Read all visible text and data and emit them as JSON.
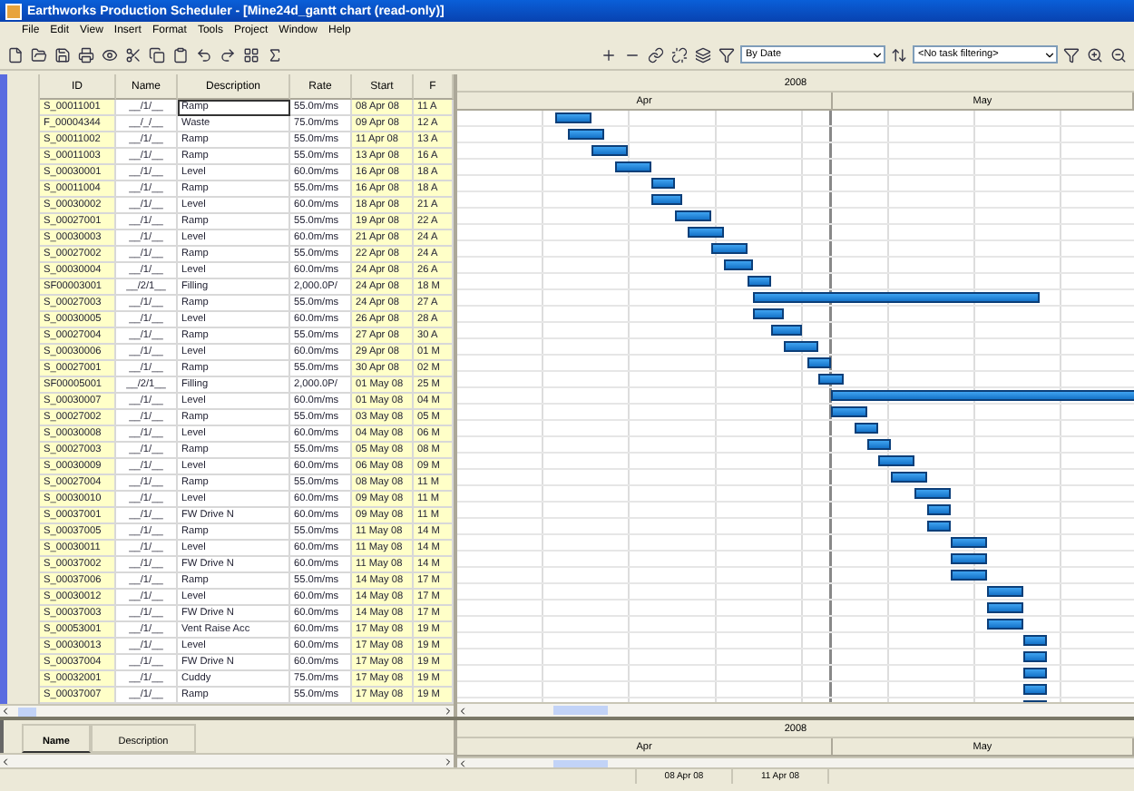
{
  "window": {
    "title": "Earthworks Production Scheduler - [Mine24d_gantt chart (read-only)]"
  },
  "menu": [
    "File",
    "Edit",
    "View",
    "Insert",
    "Format",
    "Tools",
    "Project",
    "Window",
    "Help"
  ],
  "toolbar": {
    "sort_select": "By Date",
    "filter_select": "<No task filtering>"
  },
  "table": {
    "columns": [
      "ID",
      "Name",
      "Description",
      "Rate",
      "Start",
      "F"
    ],
    "rows": [
      {
        "id": "S_00011001",
        "name": "__/1/__",
        "description": "Ramp",
        "rate": "55.0m/ms",
        "start": "08 Apr 08",
        "finish": "11 A",
        "selected": true
      },
      {
        "id": "F_00004344",
        "name": "__/_/__",
        "description": "Waste",
        "rate": "75.0m/ms",
        "start": "09 Apr 08",
        "finish": "12 A",
        "selected": false
      },
      {
        "id": "S_00011002",
        "name": "__/1/__",
        "description": "Ramp",
        "rate": "55.0m/ms",
        "start": "11 Apr 08",
        "finish": "13 A",
        "selected": false
      },
      {
        "id": "S_00011003",
        "name": "__/1/__",
        "description": "Ramp",
        "rate": "55.0m/ms",
        "start": "13 Apr 08",
        "finish": "16 A",
        "selected": false
      },
      {
        "id": "S_00030001",
        "name": "__/1/__",
        "description": "Level",
        "rate": "60.0m/ms",
        "start": "16 Apr 08",
        "finish": "18 A",
        "selected": false
      },
      {
        "id": "S_00011004",
        "name": "__/1/__",
        "description": "Ramp",
        "rate": "55.0m/ms",
        "start": "16 Apr 08",
        "finish": "18 A",
        "selected": false
      },
      {
        "id": "S_00030002",
        "name": "__/1/__",
        "description": "Level",
        "rate": "60.0m/ms",
        "start": "18 Apr 08",
        "finish": "21 A",
        "selected": false
      },
      {
        "id": "S_00027001",
        "name": "__/1/__",
        "description": "Ramp",
        "rate": "55.0m/ms",
        "start": "19 Apr 08",
        "finish": "22 A",
        "selected": false
      },
      {
        "id": "S_00030003",
        "name": "__/1/__",
        "description": "Level",
        "rate": "60.0m/ms",
        "start": "21 Apr 08",
        "finish": "24 A",
        "selected": false
      },
      {
        "id": "S_00027002",
        "name": "__/1/__",
        "description": "Ramp",
        "rate": "55.0m/ms",
        "start": "22 Apr 08",
        "finish": "24 A",
        "selected": false
      },
      {
        "id": "S_00030004",
        "name": "__/1/__",
        "description": "Level",
        "rate": "60.0m/ms",
        "start": "24 Apr 08",
        "finish": "26 A",
        "selected": false
      },
      {
        "id": "SF00003001",
        "name": "__/2/1__",
        "description": "Filling",
        "rate": "2,000.0P/",
        "start": "24 Apr 08",
        "finish": "18 M",
        "selected": false
      },
      {
        "id": "S_00027003",
        "name": "__/1/__",
        "description": "Ramp",
        "rate": "55.0m/ms",
        "start": "24 Apr 08",
        "finish": "27 A",
        "selected": false
      },
      {
        "id": "S_00030005",
        "name": "__/1/__",
        "description": "Level",
        "rate": "60.0m/ms",
        "start": "26 Apr 08",
        "finish": "28 A",
        "selected": false
      },
      {
        "id": "S_00027004",
        "name": "__/1/__",
        "description": "Ramp",
        "rate": "55.0m/ms",
        "start": "27 Apr 08",
        "finish": "30 A",
        "selected": false
      },
      {
        "id": "S_00030006",
        "name": "__/1/__",
        "description": "Level",
        "rate": "60.0m/ms",
        "start": "29 Apr 08",
        "finish": "01 M",
        "selected": false
      },
      {
        "id": "S_00027001",
        "name": "__/1/__",
        "description": "Ramp",
        "rate": "55.0m/ms",
        "start": "30 Apr 08",
        "finish": "02 M",
        "selected": false
      },
      {
        "id": "SF00005001",
        "name": "__/2/1__",
        "description": "Filling",
        "rate": "2,000.0P/",
        "start": "01 May 08",
        "finish": "25 M",
        "selected": false
      },
      {
        "id": "S_00030007",
        "name": "__/1/__",
        "description": "Level",
        "rate": "60.0m/ms",
        "start": "01 May 08",
        "finish": "04 M",
        "selected": false
      },
      {
        "id": "S_00027002",
        "name": "__/1/__",
        "description": "Ramp",
        "rate": "55.0m/ms",
        "start": "03 May 08",
        "finish": "05 M",
        "selected": false
      },
      {
        "id": "S_00030008",
        "name": "__/1/__",
        "description": "Level",
        "rate": "60.0m/ms",
        "start": "04 May 08",
        "finish": "06 M",
        "selected": false
      },
      {
        "id": "S_00027003",
        "name": "__/1/__",
        "description": "Ramp",
        "rate": "55.0m/ms",
        "start": "05 May 08",
        "finish": "08 M",
        "selected": false
      },
      {
        "id": "S_00030009",
        "name": "__/1/__",
        "description": "Level",
        "rate": "60.0m/ms",
        "start": "06 May 08",
        "finish": "09 M",
        "selected": false
      },
      {
        "id": "S_00027004",
        "name": "__/1/__",
        "description": "Ramp",
        "rate": "55.0m/ms",
        "start": "08 May 08",
        "finish": "11 M",
        "selected": false
      },
      {
        "id": "S_00030010",
        "name": "__/1/__",
        "description": "Level",
        "rate": "60.0m/ms",
        "start": "09 May 08",
        "finish": "11 M",
        "selected": false
      },
      {
        "id": "S_00037001",
        "name": "__/1/__",
        "description": "FW Drive N",
        "rate": "60.0m/ms",
        "start": "09 May 08",
        "finish": "11 M",
        "selected": false
      },
      {
        "id": "S_00037005",
        "name": "__/1/__",
        "description": "Ramp",
        "rate": "55.0m/ms",
        "start": "11 May 08",
        "finish": "14 M",
        "selected": false
      },
      {
        "id": "S_00030011",
        "name": "__/1/__",
        "description": "Level",
        "rate": "60.0m/ms",
        "start": "11 May 08",
        "finish": "14 M",
        "selected": false
      },
      {
        "id": "S_00037002",
        "name": "__/1/__",
        "description": "FW Drive N",
        "rate": "60.0m/ms",
        "start": "11 May 08",
        "finish": "14 M",
        "selected": false
      },
      {
        "id": "S_00037006",
        "name": "__/1/__",
        "description": "Ramp",
        "rate": "55.0m/ms",
        "start": "14 May 08",
        "finish": "17 M",
        "selected": false
      },
      {
        "id": "S_00030012",
        "name": "__/1/__",
        "description": "Level",
        "rate": "60.0m/ms",
        "start": "14 May 08",
        "finish": "17 M",
        "selected": false
      },
      {
        "id": "S_00037003",
        "name": "__/1/__",
        "description": "FW Drive N",
        "rate": "60.0m/ms",
        "start": "14 May 08",
        "finish": "17 M",
        "selected": false
      },
      {
        "id": "S_00053001",
        "name": "__/1/__",
        "description": "Vent Raise Acc",
        "rate": "60.0m/ms",
        "start": "17 May 08",
        "finish": "19 M",
        "selected": false
      },
      {
        "id": "S_00030013",
        "name": "__/1/__",
        "description": "Level",
        "rate": "60.0m/ms",
        "start": "17 May 08",
        "finish": "19 M",
        "selected": false
      },
      {
        "id": "S_00037004",
        "name": "__/1/__",
        "description": "FW Drive N",
        "rate": "60.0m/ms",
        "start": "17 May 08",
        "finish": "19 M",
        "selected": false
      },
      {
        "id": "S_00032001",
        "name": "__/1/__",
        "description": "Cuddy",
        "rate": "75.0m/ms",
        "start": "17 May 08",
        "finish": "19 M",
        "selected": false
      },
      {
        "id": "S_00037007",
        "name": "__/1/__",
        "description": "Ramp",
        "rate": "55.0m/ms",
        "start": "17 May 08",
        "finish": "19 M",
        "selected": false
      }
    ]
  },
  "gantt": {
    "year": "2008",
    "months": [
      "Apr",
      "May"
    ]
  },
  "bottom_pane": {
    "tabs": [
      {
        "label": "Name",
        "selected": true
      },
      {
        "label": "Description",
        "selected": false
      }
    ],
    "year": "2008",
    "months": [
      "Apr",
      "May"
    ]
  },
  "status_bar": [
    "08 Apr 08",
    "11 Apr 08"
  ]
}
